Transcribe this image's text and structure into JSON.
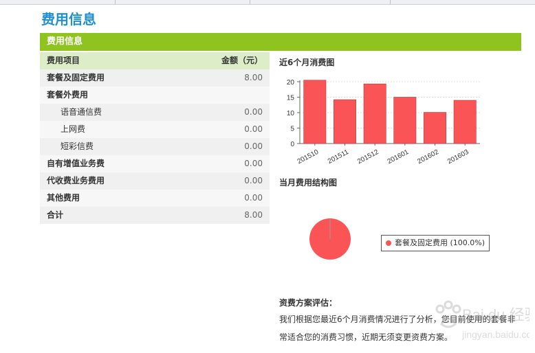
{
  "page": {
    "title": "费用信息"
  },
  "section": {
    "title": "费用信息"
  },
  "table": {
    "header": {
      "item": "费用项目",
      "amount": "金额（元）"
    },
    "rows": [
      {
        "label": "套餐及固定费用",
        "amount": "8.00"
      },
      {
        "label": "套餐外费用",
        "amount": ""
      },
      {
        "label": "语音通信费",
        "amount": "0.00"
      },
      {
        "label": "上网费",
        "amount": "0.00"
      },
      {
        "label": "短彩信费",
        "amount": "0.00"
      },
      {
        "label": "自有增值业务费",
        "amount": "0.00"
      },
      {
        "label": "代收费业务费用",
        "amount": "0.00"
      },
      {
        "label": "其他费用",
        "amount": "0.00"
      },
      {
        "label": "合计",
        "amount": "8.00"
      }
    ]
  },
  "charts": {
    "bar_title": "近6个月消费图",
    "pie_title": "当月费用结构图"
  },
  "chart_data": [
    {
      "type": "bar",
      "title": "近6个月消费图",
      "categories": [
        "201510",
        "201511",
        "201512",
        "201601",
        "201602",
        "201603"
      ],
      "values": [
        20.5,
        14.2,
        19.3,
        15.0,
        10.1,
        14.0
      ],
      "ylim": [
        0,
        20
      ],
      "yticks": [
        0,
        5,
        10,
        15,
        20
      ],
      "grid": true,
      "color": "#fa5457"
    },
    {
      "type": "pie",
      "title": "当月费用结构图",
      "slices": [
        {
          "label": "套餐及固定费用",
          "value": 100.0
        }
      ],
      "legend_text": "套餐及固定费用 (100.0%)",
      "legend_position": "right",
      "color": "#fa5457"
    }
  ],
  "evaluation": {
    "title": "资费方案评估：",
    "text": "我们根据您最近6个月消费情况进行了分析，您目前使用的套餐非常适合您的消费习惯，近期无须变更资费方案。"
  },
  "watermark": {
    "text": "Bai du 经验",
    "url": "jingyan.baidu.com"
  },
  "colors": {
    "accent_green": "#8fc31f",
    "title_blue": "#1f8fd1",
    "bar_red": "#fa5457"
  }
}
